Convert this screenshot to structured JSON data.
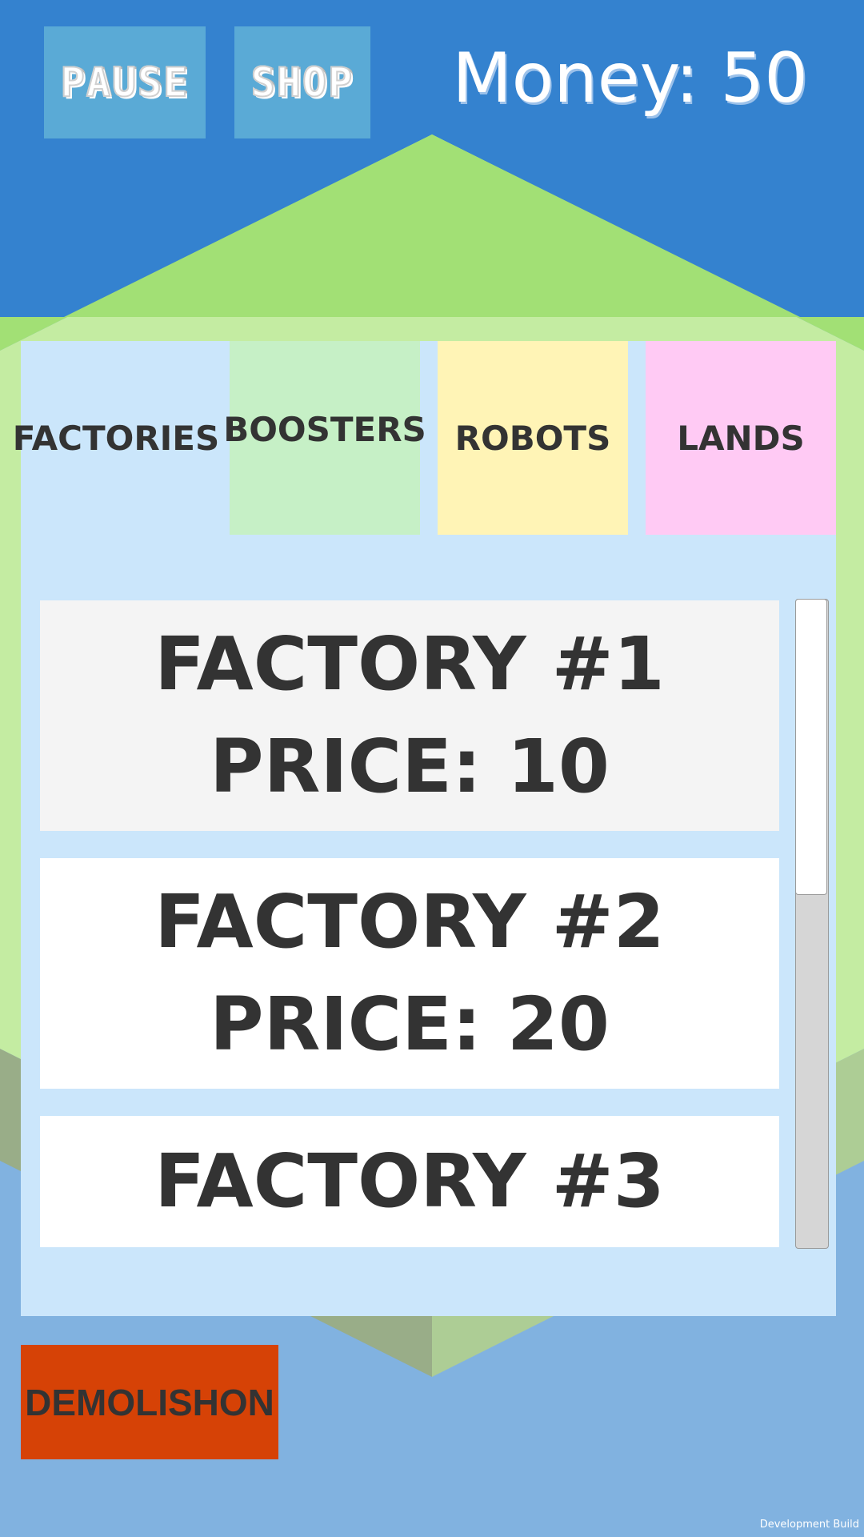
{
  "hud": {
    "pause_label": "PAUSE",
    "shop_label": "SHOP",
    "money_label": "Money: 50",
    "money_value": 50
  },
  "tabs": [
    {
      "label": "FACTORIES",
      "color": "#cbe6fb",
      "selected": true
    },
    {
      "label": "BOOSTERS",
      "color": "#c6f0c6",
      "selected": false
    },
    {
      "label": "ROBOTS",
      "color": "#fff4b6",
      "selected": false
    },
    {
      "label": "LANDS",
      "color": "#ffcaf4",
      "selected": false
    }
  ],
  "items": [
    {
      "name": "FACTORY #1",
      "price": "PRICE: 10"
    },
    {
      "name": "FACTORY #2",
      "price": "PRICE: 20"
    },
    {
      "name": "FACTORY #3",
      "price": ""
    }
  ],
  "demolish_label": "DEMOLISHON",
  "footer": "Development Build",
  "colors": {
    "sky": "#3482cf",
    "lower_background": "#81b2e0",
    "hill_green": "#a2e075",
    "demolish": "#d64206",
    "panel": "#cbe6fb",
    "text": "#333333"
  }
}
